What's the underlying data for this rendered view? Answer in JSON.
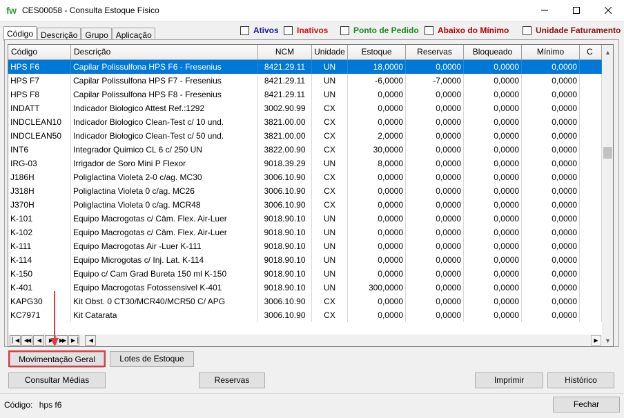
{
  "window": {
    "logo": "fw",
    "title": "CES00058 - Consulta Estoque Físico"
  },
  "tabs": [
    {
      "label": "Código",
      "active": true
    },
    {
      "label": "Descrição",
      "active": false
    },
    {
      "label": "Grupo",
      "active": false
    },
    {
      "label": "Aplicação",
      "active": false
    }
  ],
  "filters": [
    {
      "label": "Ativos",
      "color": "#1a1aa6",
      "checked": false
    },
    {
      "label": "Inativos",
      "color": "#cc1111",
      "checked": false
    },
    {
      "label": "Ponto de Pedido",
      "color": "#1a8a1a",
      "checked": false
    },
    {
      "label": "Abaixo do Mínimo",
      "color": "#b00000",
      "checked": false
    },
    {
      "label": "Unidade Faturamento",
      "color": "#8a1010",
      "checked": false
    }
  ],
  "grid": {
    "columns": [
      "Código",
      "Descrição",
      "NCM",
      "Unidade",
      "Estoque",
      "Reservas",
      "Bloqueado",
      "Mínimo",
      "C"
    ],
    "selected_row": 0,
    "rows": [
      [
        "HPS F6",
        "Capilar Polissulfona HPS F6 - Fresenius",
        "8421.29.11",
        "UN",
        "18,0000",
        "0,0000",
        "0,0000",
        "0,0000"
      ],
      [
        "HPS F7",
        "Capilar Polissulfona HPS F7 - Fresenius",
        "8421.29.11",
        "UN",
        "-6,0000",
        "-7,0000",
        "0,0000",
        "0,0000"
      ],
      [
        "HPS F8",
        "Capilar Polissulfona HPS F8 - Fresenius",
        "8421.29.11",
        "UN",
        "0,0000",
        "0,0000",
        "0,0000",
        "0,0000"
      ],
      [
        "INDATT",
        "Indicador Biologico Attest Ref.:1292",
        "3002.90.99",
        "CX",
        "0,0000",
        "0,0000",
        "0,0000",
        "0,0000"
      ],
      [
        "INDCLEAN10",
        "Indicador Biologico Clean-Test c/ 10 und.",
        "3821.00.00",
        "CX",
        "0,0000",
        "0,0000",
        "0,0000",
        "0,0000"
      ],
      [
        "INDCLEAN50",
        "Indicador Biologico Clean-Test c/ 50 und.",
        "3821.00.00",
        "CX",
        "2,0000",
        "0,0000",
        "0,0000",
        "0,0000"
      ],
      [
        "INT6",
        "Integrador Quimico CL 6 c/ 250 UN",
        "3822.00.90",
        "CX",
        "30,0000",
        "0,0000",
        "0,0000",
        "0,0000"
      ],
      [
        "IRG-03",
        "Irrigador de Soro Mini P Flexor",
        "9018.39.29",
        "UN",
        "8,0000",
        "0,0000",
        "0,0000",
        "0,0000"
      ],
      [
        "J186H",
        "Poliglactina Violeta 2-0 c/ag. MC30",
        "3006.10.90",
        "CX",
        "0,0000",
        "0,0000",
        "0,0000",
        "0,0000"
      ],
      [
        "J318H",
        "Poliglactina Violeta 0 c/ag. MC26",
        "3006.10.90",
        "CX",
        "0,0000",
        "0,0000",
        "0,0000",
        "0,0000"
      ],
      [
        "J370H",
        "Poliglactina Violeta 0 c/ag. MCR48",
        "3006.10.90",
        "CX",
        "0,0000",
        "0,0000",
        "0,0000",
        "0,0000"
      ],
      [
        "K-101",
        "Equipo Macrogotas c/ Câm. Flex. Air-Luer",
        "9018.90.10",
        "UN",
        "0,0000",
        "0,0000",
        "0,0000",
        "0,0000"
      ],
      [
        "K-102",
        "Equipo Macrogotas c/ Câm. Flex. Air-Luer",
        "9018.90.10",
        "UN",
        "0,0000",
        "0,0000",
        "0,0000",
        "0,0000"
      ],
      [
        "K-111",
        "Equipo Macrogotas Air -Luer K-111",
        "9018.90.10",
        "UN",
        "0,0000",
        "0,0000",
        "0,0000",
        "0,0000"
      ],
      [
        "K-114",
        "Equipo Microgotas c/ Inj. Lat. K-114",
        "9018.90.10",
        "UN",
        "0,0000",
        "0,0000",
        "0,0000",
        "0,0000"
      ],
      [
        "K-150",
        "Equipo c/ Cam Grad Bureta 150 ml K-150",
        "9018.90.10",
        "UN",
        "0,0000",
        "0,0000",
        "0,0000",
        "0,0000"
      ],
      [
        "K-401",
        "Equipo Macrogotas Fotossensivel K-401",
        "9018.90.10",
        "UN",
        "300,0000",
        "0,0000",
        "0,0000",
        "0,0000"
      ],
      [
        "KAPG30",
        "Kit Obst. 0 CT30/MCR40/MCR50 C/ APG",
        "3006.10.90",
        "CX",
        "0,0000",
        "0,0000",
        "0,0000",
        "0,0000"
      ],
      [
        "KC7971",
        "Kit Catarata",
        "3006.10.90",
        "CX",
        "0,0000",
        "0,0000",
        "0,0000",
        "0,0000"
      ]
    ]
  },
  "buttons": {
    "movimentacao": "Movimentação Geral",
    "lotes": "Lotes de Estoque",
    "medias": "Consultar Médias",
    "reservas": "Reservas",
    "imprimir": "Imprimir",
    "historico": "Histórico",
    "fechar": "Fechar"
  },
  "status": {
    "label": "Código:",
    "value": "hps f6"
  },
  "annotation_color": "#e0393e",
  "selection_color": "#0078d7"
}
